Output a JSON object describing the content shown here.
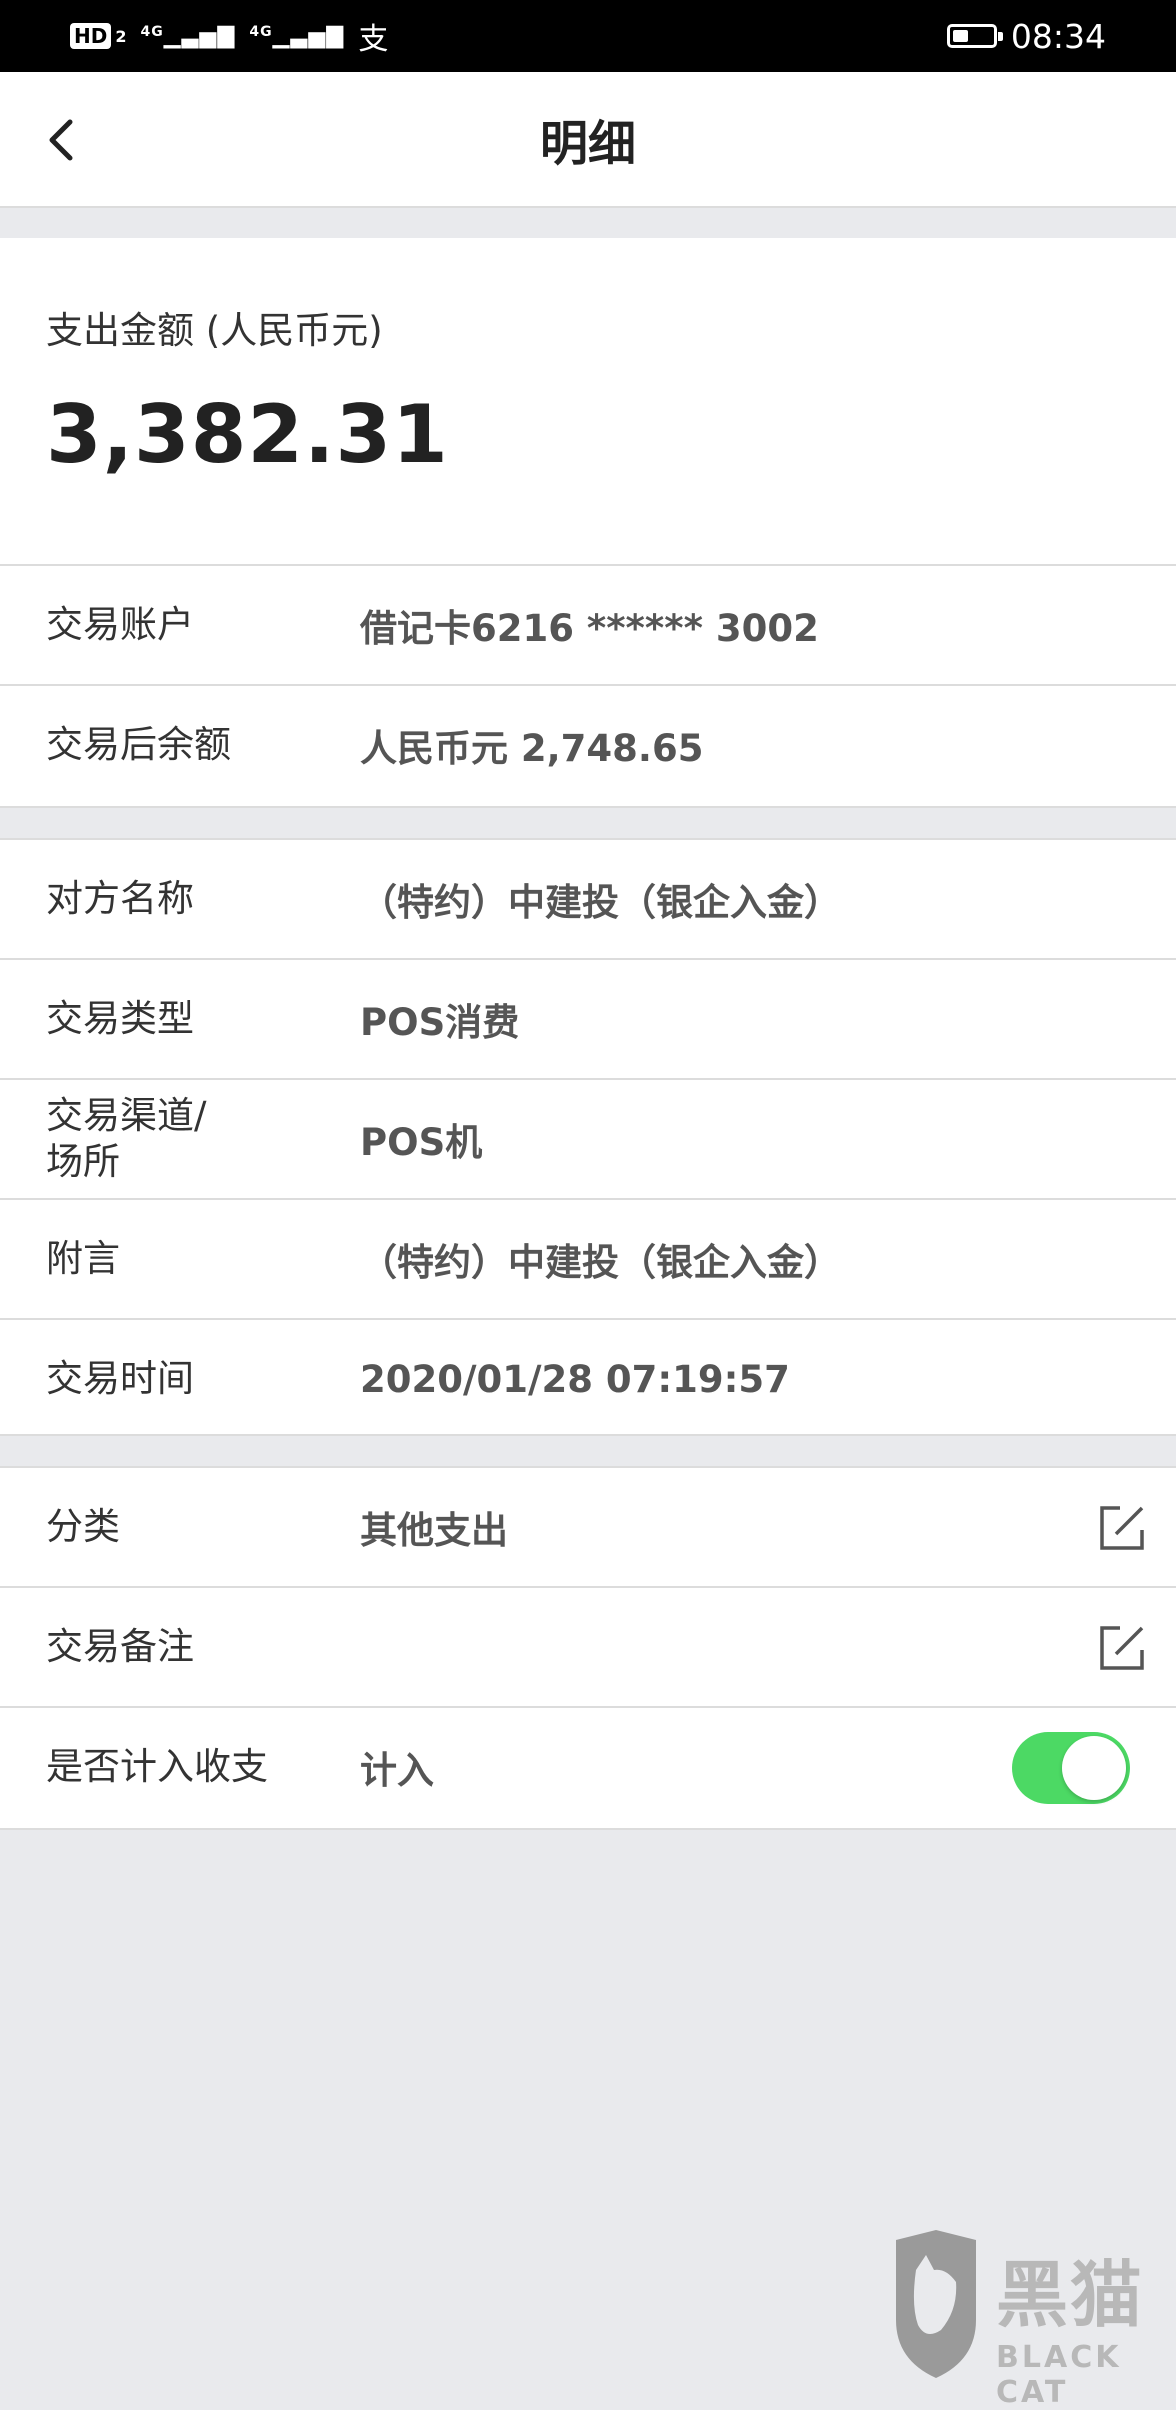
{
  "status_bar": {
    "hd": "HD",
    "hd_sub": "2",
    "signal1": "4G",
    "signal2": "4G",
    "pay_glyph": "支",
    "time": "08:34",
    "battery_level": 0.4
  },
  "nav": {
    "title": "明细",
    "back_icon": "chevron-left-icon"
  },
  "amount": {
    "label": "支出金额 (人民币元)",
    "value": "3,382.31"
  },
  "group_a": [
    {
      "label": "交易账户",
      "value": "借记卡6216 ****** 3002"
    },
    {
      "label": "交易后余额",
      "value": "人民币元 2,748.65"
    }
  ],
  "group_b": [
    {
      "label": "对方名称",
      "value": "（特约）中建投（银企入金）"
    },
    {
      "label": "交易类型",
      "value": "POS消费"
    },
    {
      "label": "交易渠道/\n场所",
      "value": "POS机"
    },
    {
      "label": "附言",
      "value": "（特约）中建投（银企入金）"
    },
    {
      "label": "交易时间",
      "value": "2020/01/28 07:19:57"
    }
  ],
  "group_c": {
    "category": {
      "label": "分类",
      "value": "其他支出",
      "icon": "edit-icon"
    },
    "note": {
      "label": "交易备注",
      "value": "",
      "icon": "edit-icon"
    },
    "include": {
      "label": "是否计入收支",
      "value": "计入",
      "toggle_on": true,
      "toggle_color": "#4cd964"
    }
  },
  "watermark": {
    "cn": "黑猫",
    "en": "BLACK CAT"
  }
}
